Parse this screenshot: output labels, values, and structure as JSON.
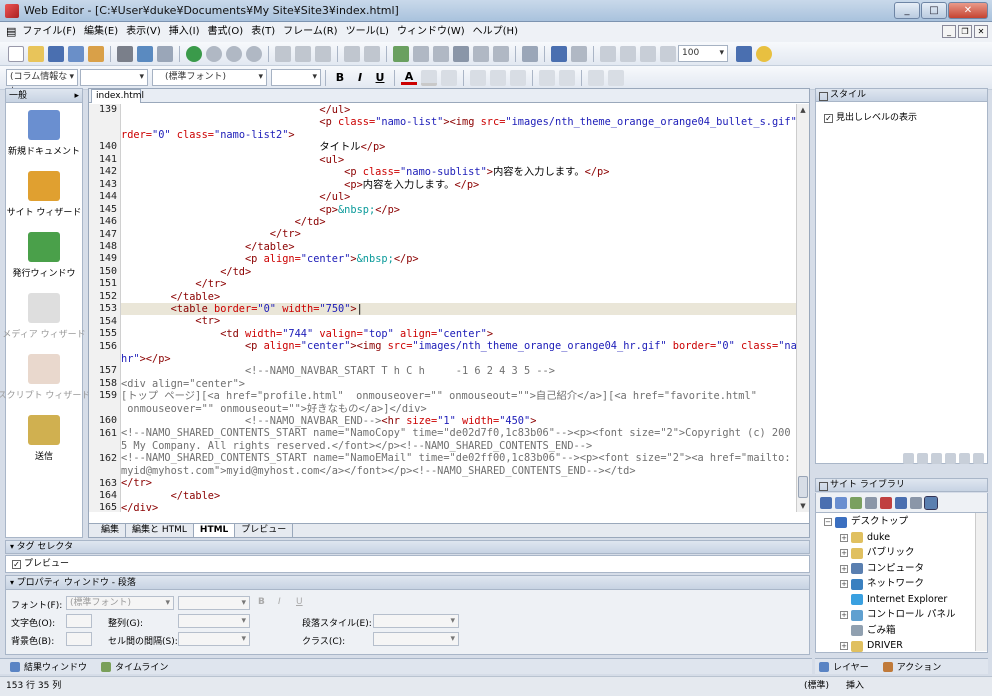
{
  "window": {
    "title": "Web Editor - [C:¥User¥duke¥Documents¥My Site¥Site3¥index.html]",
    "buttons": [
      "_",
      "□",
      "✕"
    ]
  },
  "menu": [
    "ファイル(F)",
    "編集(E)",
    "表示(V)",
    "挿入(I)",
    "書式(O)",
    "表(T)",
    "フレーム(R)",
    "ツール(L)",
    "ウィンドウ(W)",
    "ヘルプ(H)"
  ],
  "toolbar": {
    "zoom": "100",
    "column_info": "(コラム情報なし",
    "font": "(標準フォント)"
  },
  "format_buttons": {
    "bold": "B",
    "italic": "I",
    "underline": "U",
    "font_color": "A"
  },
  "left_panel": {
    "header": "一般",
    "items": [
      {
        "label": "新規ドキュメント",
        "color": "#6a8fd0",
        "enabled": true
      },
      {
        "label": "サイト ウィザード",
        "color": "#e0a030",
        "enabled": true
      },
      {
        "label": "発行ウィンドウ",
        "color": "#4aa04a",
        "enabled": true
      },
      {
        "label": "メディア ウィザード",
        "color": "#a0a0a0",
        "enabled": false
      },
      {
        "label": "スクリプト ウィザード",
        "color": "#c09070",
        "enabled": false
      },
      {
        "label": "送信",
        "color": "#d0b050",
        "enabled": true
      }
    ]
  },
  "editor": {
    "file_tab": "index.html",
    "view_tabs": [
      "編集",
      "編集と HTML",
      "HTML",
      "プレビュー"
    ],
    "active_view": "HTML",
    "lines": [
      {
        "n": "139",
        "parts": [
          [
            "t",
            "                                </ul>"
          ]
        ]
      },
      {
        "n": "",
        "parts": [
          [
            "t",
            "                                <p "
          ],
          [
            "a",
            "class="
          ],
          [
            "v",
            "\"namo-list\""
          ],
          [
            "t",
            "><img "
          ],
          [
            "a",
            "src="
          ],
          [
            "v",
            "\"images/nth_theme_orange_orange04_bullet_s.gif\""
          ],
          [
            "a",
            " bo"
          ]
        ]
      },
      {
        "n": "",
        "parts": [
          [
            "a",
            "rder="
          ],
          [
            "v",
            "\"0\""
          ],
          [
            "a",
            " class="
          ],
          [
            "v",
            "\"namo-list2\""
          ],
          [
            "t",
            ">"
          ]
        ]
      },
      {
        "n": "140",
        "parts": [
          [
            "x",
            "                                タイトル"
          ],
          [
            "t",
            "</p>"
          ]
        ]
      },
      {
        "n": "141",
        "parts": [
          [
            "t",
            "                                <ul>"
          ]
        ]
      },
      {
        "n": "142",
        "parts": [
          [
            "t",
            "                                    <p "
          ],
          [
            "a",
            "class="
          ],
          [
            "v",
            "\"namo-sublist\""
          ],
          [
            "t",
            ">"
          ],
          [
            "x",
            "内容を入力します。"
          ],
          [
            "t",
            "</p>"
          ]
        ]
      },
      {
        "n": "143",
        "parts": [
          [
            "t",
            "                                    <p>"
          ],
          [
            "x",
            "内容を入力します。"
          ],
          [
            "t",
            "</p>"
          ]
        ]
      },
      {
        "n": "144",
        "parts": [
          [
            "t",
            "                                </ul>"
          ]
        ]
      },
      {
        "n": "145",
        "parts": [
          [
            "t",
            "                                <p>"
          ],
          [
            "e",
            "&nbsp;"
          ],
          [
            "t",
            "</p>"
          ]
        ]
      },
      {
        "n": "146",
        "parts": [
          [
            "t",
            "                            </td>"
          ]
        ]
      },
      {
        "n": "147",
        "parts": [
          [
            "t",
            "                        </tr>"
          ]
        ]
      },
      {
        "n": "148",
        "parts": [
          [
            "t",
            "                    </table>"
          ]
        ]
      },
      {
        "n": "149",
        "parts": [
          [
            "t",
            "                    <p "
          ],
          [
            "a",
            "align="
          ],
          [
            "v",
            "\"center\""
          ],
          [
            "t",
            ">"
          ],
          [
            "e",
            "&nbsp;"
          ],
          [
            "t",
            "</p>"
          ]
        ]
      },
      {
        "n": "150",
        "parts": [
          [
            "t",
            "                </td>"
          ]
        ]
      },
      {
        "n": "151",
        "parts": [
          [
            "t",
            "            </tr>"
          ]
        ]
      },
      {
        "n": "152",
        "parts": [
          [
            "t",
            "        </table>"
          ]
        ]
      },
      {
        "n": "153",
        "cur": true,
        "parts": [
          [
            "t",
            "        <table "
          ],
          [
            "a",
            "border="
          ],
          [
            "v",
            "\"0\""
          ],
          [
            "a",
            " width="
          ],
          [
            "v",
            "\"750\""
          ],
          [
            "t",
            ">"
          ],
          [
            "x",
            "|"
          ]
        ]
      },
      {
        "n": "154",
        "parts": [
          [
            "t",
            "            <tr>"
          ]
        ]
      },
      {
        "n": "155",
        "parts": [
          [
            "t",
            "                <td "
          ],
          [
            "a",
            "width="
          ],
          [
            "v",
            "\"744\""
          ],
          [
            "a",
            " valign="
          ],
          [
            "v",
            "\"top\""
          ],
          [
            "a",
            " align="
          ],
          [
            "v",
            "\"center\""
          ],
          [
            "t",
            ">"
          ]
        ]
      },
      {
        "n": "156",
        "parts": [
          [
            "t",
            "                    <p "
          ],
          [
            "a",
            "align="
          ],
          [
            "v",
            "\"center\""
          ],
          [
            "t",
            "><img "
          ],
          [
            "a",
            "src="
          ],
          [
            "v",
            "\"images/nth_theme_orange_orange04_hr.gif\""
          ],
          [
            "a",
            " border="
          ],
          [
            "v",
            "\"0\""
          ],
          [
            "a",
            " class="
          ],
          [
            "v",
            "\"namo-"
          ]
        ]
      },
      {
        "n": "",
        "parts": [
          [
            "v",
            "hr\""
          ],
          [
            "t",
            "></p>"
          ]
        ]
      },
      {
        "n": "157",
        "parts": [
          [
            "c",
            "                    <!--NAMO_NAVBAR_START T h C h     -1 6 2 4 3 5 -->"
          ]
        ]
      },
      {
        "n": "158",
        "parts": [
          [
            "c",
            "<div align=\"center\">"
          ]
        ]
      },
      {
        "n": "159",
        "parts": [
          [
            "c",
            "[トップ ページ][<a href=\"profile.html\"  onmouseover=\"\" onmouseout=\"\">自己紹介</a>][<a href=\"favorite.html\""
          ]
        ]
      },
      {
        "n": "",
        "parts": [
          [
            "c",
            " onmouseover=\"\" onmouseout=\"\">好きなもの</a>]</div>"
          ]
        ]
      },
      {
        "n": "160",
        "parts": [
          [
            "c",
            "                    <!--NAMO_NAVBAR_END-->"
          ],
          [
            "t",
            "<hr "
          ],
          [
            "a",
            "size="
          ],
          [
            "v",
            "\"1\""
          ],
          [
            "a",
            " width="
          ],
          [
            "v",
            "\"450\""
          ],
          [
            "t",
            ">"
          ]
        ]
      },
      {
        "n": "161",
        "parts": [
          [
            "c",
            "<!--NAMO_SHARED_CONTENTS_START name=\"NamoCopy\" time=\"de02d7f0,1c83b06\"--><p><font size=\"2\">Copyright (c) 200"
          ]
        ]
      },
      {
        "n": "",
        "parts": [
          [
            "c",
            "5 My Company. All rights reserved.</font></p><!--NAMO_SHARED_CONTENTS_END-->"
          ]
        ]
      },
      {
        "n": "162",
        "parts": [
          [
            "c",
            "<!--NAMO_SHARED_CONTENTS_START name=\"NamoEMail\" time=\"de02ff00,1c83b06\"--><p><font size=\"2\"><a href=\"mailto:"
          ]
        ]
      },
      {
        "n": "",
        "parts": [
          [
            "c",
            "myid@myhost.com\">myid@myhost.com</a></font></p><!--NAMO_SHARED_CONTENTS_END--></td>"
          ]
        ]
      },
      {
        "n": "163",
        "parts": [
          [
            "t",
            "</tr>"
          ]
        ]
      },
      {
        "n": "164",
        "parts": [
          [
            "t",
            "        </table>"
          ]
        ]
      },
      {
        "n": "165",
        "parts": [
          [
            "t",
            "</div>"
          ]
        ]
      }
    ]
  },
  "tag_selector": {
    "title": "タグ セレクタ",
    "option": "プレビュー",
    "checked": true
  },
  "property_window": {
    "title": "プロパティ ウィンドウ - 段落",
    "font_label": "フォント(F):",
    "font_value": "(標準フォント)",
    "text_color_label": "文字色(O):",
    "align_label": "整列(G):",
    "para_style_label": "段落スタイル(E):",
    "bg_color_label": "背景色(B):",
    "cell_spacing_label": "セル間の間隔(S):",
    "class_label": "クラス(C):",
    "bold": "B",
    "italic": "I",
    "underline": "U"
  },
  "bottom_tabs": [
    "結果ウィンドウ",
    "タイムライン"
  ],
  "status": {
    "position": "153 行  35 列",
    "mode": "(標準)",
    "insert": "挿入"
  },
  "right_panel": {
    "style_title": "スタイル",
    "style_option": "見出しレベルの表示",
    "style_option_checked": true,
    "site_title": "サイト ライブラリ",
    "tree": [
      {
        "label": "デスクトップ",
        "level": 0,
        "exp": "−",
        "color": "#3a6fc0"
      },
      {
        "label": "duke",
        "level": 1,
        "exp": "+",
        "color": "#e0c060"
      },
      {
        "label": "パブリック",
        "level": 1,
        "exp": "+",
        "color": "#e0c060"
      },
      {
        "label": "コンピュータ",
        "level": 1,
        "exp": "+",
        "color": "#5a7fb0"
      },
      {
        "label": "ネットワーク",
        "level": 1,
        "exp": "+",
        "color": "#3a80c0"
      },
      {
        "label": "Internet Explorer",
        "level": 1,
        "exp": "",
        "color": "#3aa0e0"
      },
      {
        "label": "コントロール パネル",
        "level": 1,
        "exp": "+",
        "color": "#60a0d0"
      },
      {
        "label": "ごみ箱",
        "level": 1,
        "exp": "",
        "color": "#90a0b0"
      },
      {
        "label": "DRIVER",
        "level": 1,
        "exp": "+",
        "color": "#e0c060"
      }
    ],
    "tabs": [
      "レイヤー",
      "アクション"
    ]
  }
}
